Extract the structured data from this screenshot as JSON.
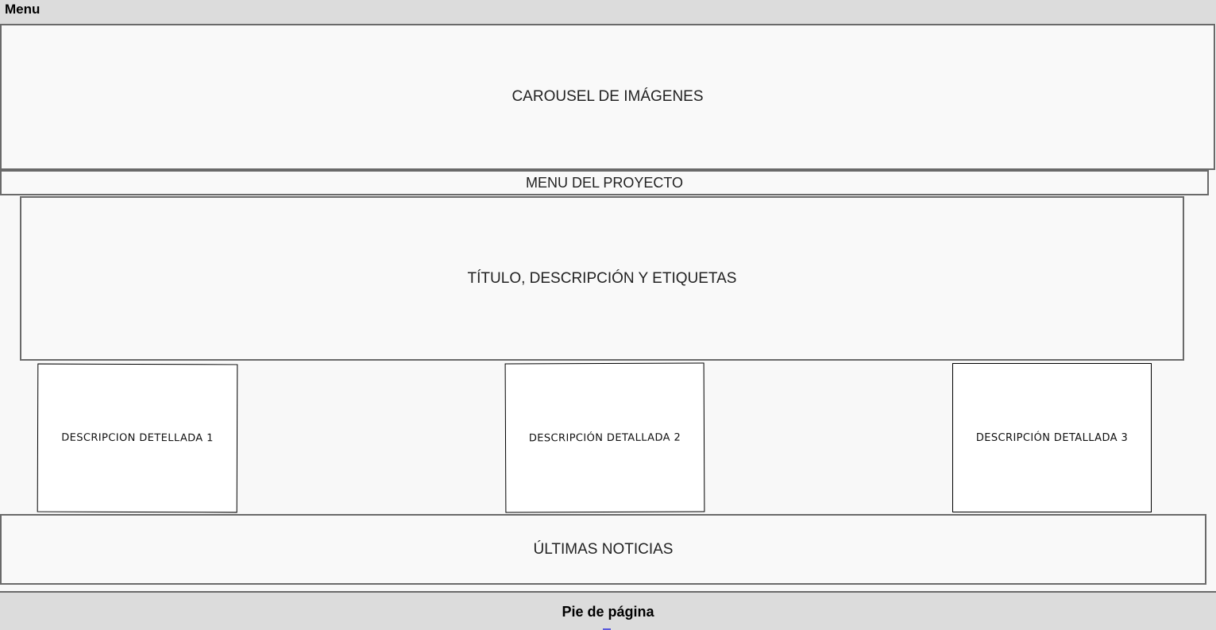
{
  "header": {
    "label": "Menu"
  },
  "carousel": {
    "label": "CAROUSEL DE IMÁGENES"
  },
  "project_menu": {
    "label": "MENU DEL PROYECTO"
  },
  "title_section": {
    "label": "TÍTULO, DESCRIPCIÓN Y ETIQUETAS"
  },
  "detail_cards": [
    {
      "label": "DESCRIPCION DETELLADA 1"
    },
    {
      "label": "DESCRIPCIÓN DETALLADA 2"
    },
    {
      "label": "DESCRIPCIÓN DETALLADA 3"
    }
  ],
  "news": {
    "label": "ÚLTIMAS NOTICIAS"
  },
  "footer": {
    "label": "Pie de página"
  },
  "colors": {
    "bar_background": "#dcdcdc",
    "canvas_background": "#f8f8f8",
    "box_border": "#6a6a6a",
    "card_border": "#000000",
    "footer_marker": "#5a5adc"
  }
}
